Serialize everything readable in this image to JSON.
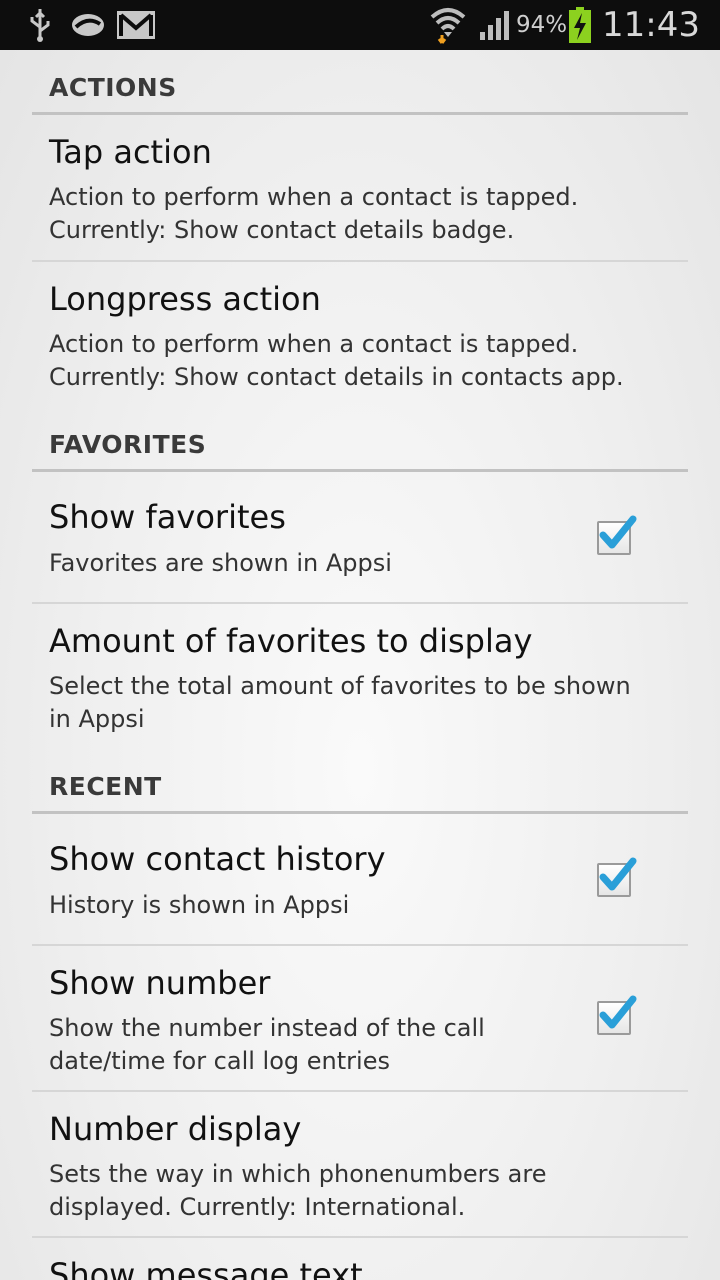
{
  "status_bar": {
    "icons": [
      "usb-icon",
      "voicemail-icon",
      "gmail-icon",
      "wifi-icon",
      "signal-icon",
      "battery-charging-icon"
    ],
    "battery_percent": "94%",
    "time": "11:43"
  },
  "sections": {
    "actions": {
      "header": "ACTIONS",
      "tap_action": {
        "title": "Tap action",
        "summary_line1": "Action to perform when a contact is tapped.",
        "summary_line2": "Currently: Show contact details badge."
      },
      "longpress_action": {
        "title": "Longpress action",
        "summary_line1": "Action to perform when a contact is tapped.",
        "summary_line2": "Currently: Show contact details in contacts app."
      }
    },
    "favorites": {
      "header": "FAVORITES",
      "show_favorites": {
        "title": "Show favorites",
        "summary": "Favorites are shown in Appsi",
        "checked": true
      },
      "amount_favorites": {
        "title": "Amount of favorites to display",
        "summary_line1": "Select the total amount of favorites to be shown",
        "summary_line2": "in Appsi"
      }
    },
    "recent": {
      "header": "RECENT",
      "show_contact_history": {
        "title": "Show contact history",
        "summary": "History is shown in Appsi",
        "checked": true
      },
      "show_number": {
        "title": "Show number",
        "summary_line1": "Show the number instead of the call",
        "summary_line2": "date/time for call log entries",
        "checked": true
      },
      "number_display": {
        "title": "Number display",
        "summary_line1": "Sets the way in which phonenumbers are",
        "summary_line2": "displayed. Currently: International."
      },
      "show_message_text": {
        "title": "Show message text"
      }
    }
  },
  "colors": {
    "checkmark": "#2a9fd8",
    "status_bar_bg": "#0d0d0d",
    "battery_fill": "#8cd11f"
  }
}
